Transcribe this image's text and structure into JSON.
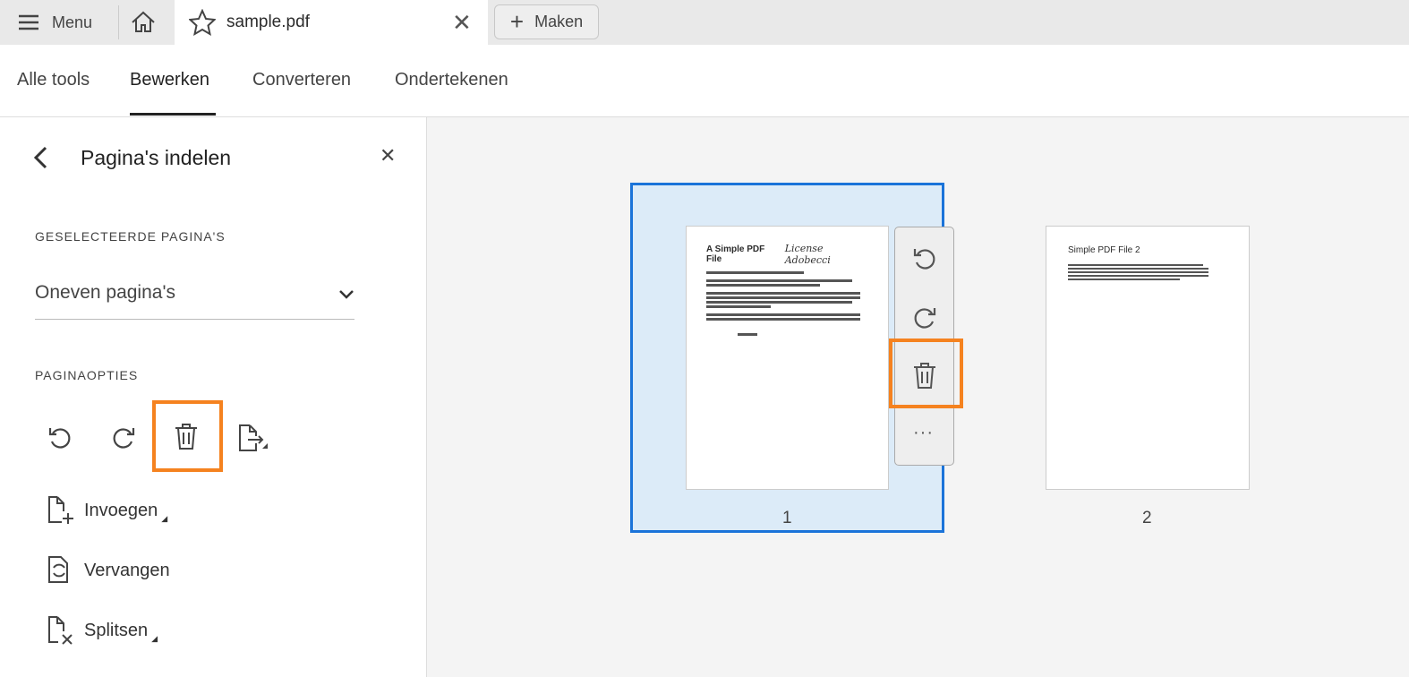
{
  "tabbar": {
    "menu_label": "Menu",
    "doc_tab": "sample.pdf",
    "create_label": "Maken"
  },
  "toolbar": {
    "tabs": [
      "Alle tools",
      "Bewerken",
      "Converteren",
      "Ondertekenen"
    ],
    "active": "Bewerken"
  },
  "sidebar": {
    "title": "Pagina's indelen",
    "selected_pages_heading": "GESELECTEERDE PAGINA'S",
    "selected_pages_value": "Oneven pagina's",
    "page_options_heading": "PAGINAOPTIES",
    "options": [
      "Invoegen",
      "Vervangen",
      "Splitsen"
    ]
  },
  "pages": [
    {
      "number": "1",
      "title": "A Simple PDF File",
      "signature": "License Adobecci",
      "selected": true
    },
    {
      "number": "2",
      "title": "Simple PDF File 2",
      "selected": false
    }
  ],
  "colors": {
    "highlight": "#f5821f",
    "selection": "#1a73d9"
  }
}
